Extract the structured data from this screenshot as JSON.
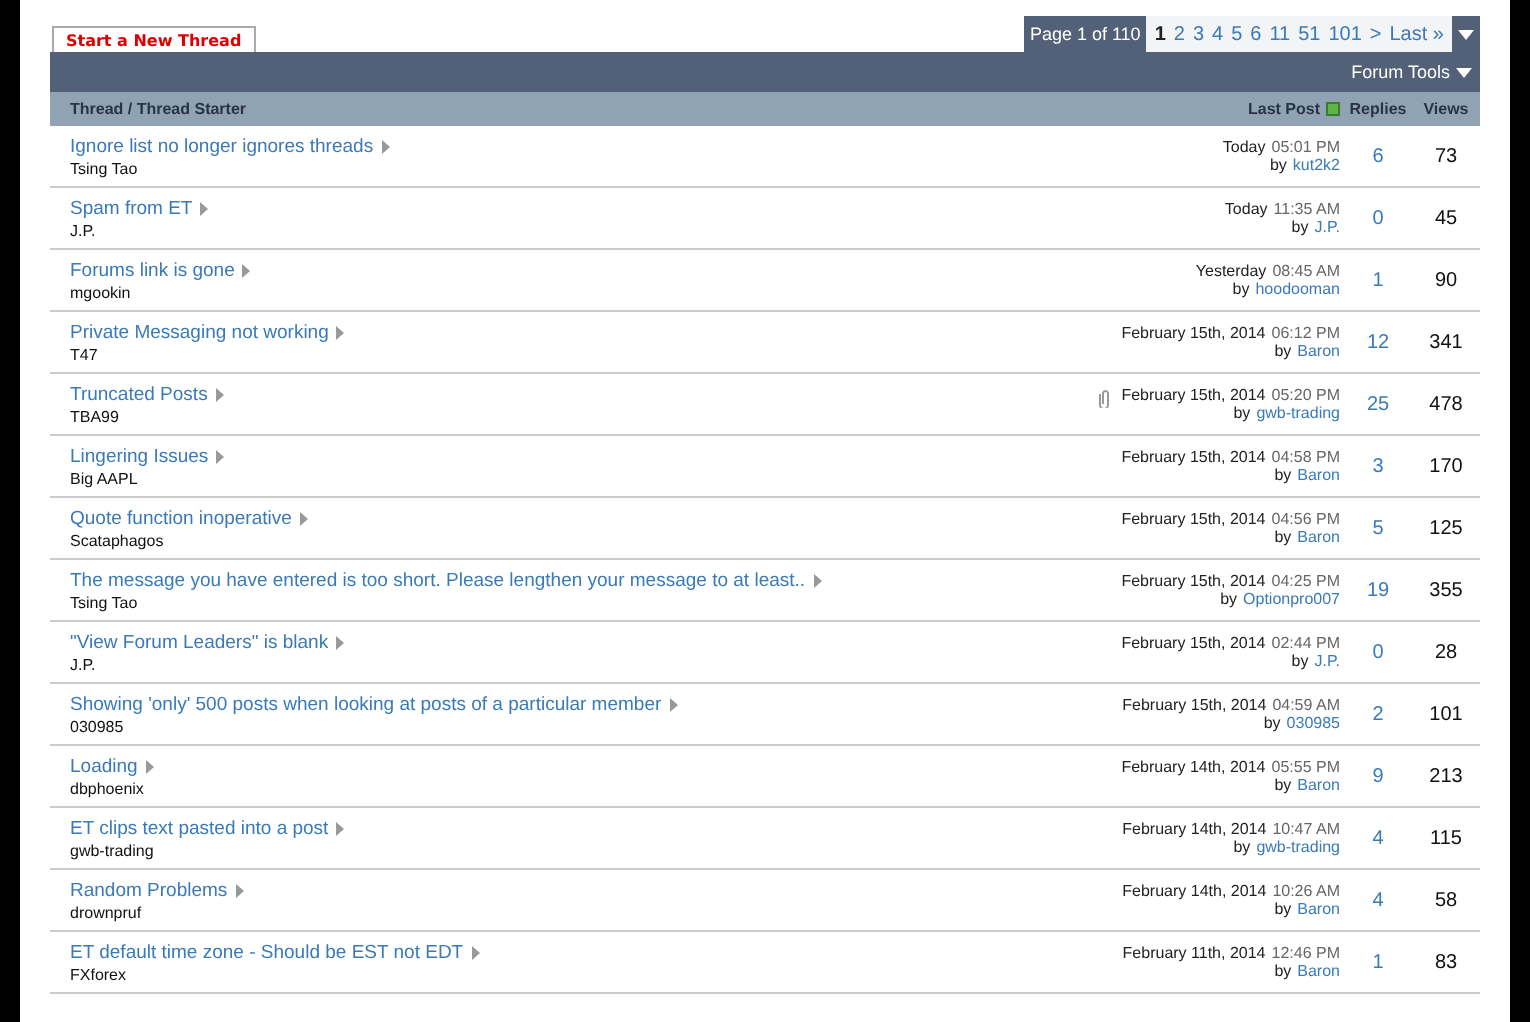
{
  "new_thread_button": "Start a New Thread",
  "pagination": {
    "summary": "Page 1 of 110",
    "pages": [
      {
        "label": "1",
        "selected": true
      },
      {
        "label": "2",
        "selected": false
      },
      {
        "label": "3",
        "selected": false
      },
      {
        "label": "4",
        "selected": false
      },
      {
        "label": "5",
        "selected": false
      },
      {
        "label": "6",
        "selected": false
      },
      {
        "label": "11",
        "selected": false
      },
      {
        "label": "51",
        "selected": false
      },
      {
        "label": "101",
        "selected": false
      }
    ],
    "next": ">",
    "last": "Last »"
  },
  "forum_tools": "Forum Tools",
  "columns": {
    "thread": "Thread / Thread Starter",
    "last_post": "Last Post",
    "replies": "Replies",
    "views": "Views"
  },
  "threads": [
    {
      "title": "Ignore list no longer ignores threads",
      "starter": "Tsing Tao",
      "date": "Today",
      "time": "05:01 PM",
      "by": "by",
      "last_user": "kut2k2",
      "replies": "6",
      "views": "73",
      "attachment": false
    },
    {
      "title": "Spam from ET",
      "starter": "J.P.",
      "date": "Today",
      "time": "11:35 AM",
      "by": "by",
      "last_user": "J.P.",
      "replies": "0",
      "views": "45",
      "attachment": false
    },
    {
      "title": "Forums link is gone",
      "starter": "mgookin",
      "date": "Yesterday",
      "time": "08:45 AM",
      "by": "by",
      "last_user": "hoodooman",
      "replies": "1",
      "views": "90",
      "attachment": false
    },
    {
      "title": "Private Messaging not working",
      "starter": "T47",
      "date": "February 15th, 2014",
      "time": "06:12 PM",
      "by": "by",
      "last_user": "Baron",
      "replies": "12",
      "views": "341",
      "attachment": false
    },
    {
      "title": "Truncated Posts",
      "starter": "TBA99",
      "date": "February 15th, 2014",
      "time": "05:20 PM",
      "by": "by",
      "last_user": "gwb-trading",
      "replies": "25",
      "views": "478",
      "attachment": true
    },
    {
      "title": "Lingering Issues",
      "starter": "Big AAPL",
      "date": "February 15th, 2014",
      "time": "04:58 PM",
      "by": "by",
      "last_user": "Baron",
      "replies": "3",
      "views": "170",
      "attachment": false
    },
    {
      "title": "Quote function inoperative",
      "starter": "Scataphagos",
      "date": "February 15th, 2014",
      "time": "04:56 PM",
      "by": "by",
      "last_user": "Baron",
      "replies": "5",
      "views": "125",
      "attachment": false
    },
    {
      "title": "The message you have entered is too short. Please lengthen your message to at least..",
      "starter": "Tsing Tao",
      "date": "February 15th, 2014",
      "time": "04:25 PM",
      "by": "by",
      "last_user": "Optionpro007",
      "replies": "19",
      "views": "355",
      "attachment": false
    },
    {
      "title": "\"View Forum Leaders\" is blank",
      "starter": "J.P.",
      "date": "February 15th, 2014",
      "time": "02:44 PM",
      "by": "by",
      "last_user": "J.P.",
      "replies": "0",
      "views": "28",
      "attachment": false
    },
    {
      "title": "Showing 'only' 500 posts when looking at posts of a particular member",
      "starter": "030985",
      "date": "February 15th, 2014",
      "time": "04:59 AM",
      "by": "by",
      "last_user": "030985",
      "replies": "2",
      "views": "101",
      "attachment": false
    },
    {
      "title": "Loading",
      "starter": "dbphoenix",
      "date": "February 14th, 2014",
      "time": "05:55 PM",
      "by": "by",
      "last_user": "Baron",
      "replies": "9",
      "views": "213",
      "attachment": false
    },
    {
      "title": "ET clips text pasted into a post",
      "starter": "gwb-trading",
      "date": "February 14th, 2014",
      "time": "10:47 AM",
      "by": "by",
      "last_user": "gwb-trading",
      "replies": "4",
      "views": "115",
      "attachment": false
    },
    {
      "title": "Random Problems",
      "starter": "drownpruf",
      "date": "February 14th, 2014",
      "time": "10:26 AM",
      "by": "by",
      "last_user": "Baron",
      "replies": "4",
      "views": "58",
      "attachment": false
    },
    {
      "title": "ET default time zone - Should be EST not EDT",
      "starter": "FXforex",
      "date": "February 11th, 2014",
      "time": "12:46 PM",
      "by": "by",
      "last_user": "Baron",
      "replies": "1",
      "views": "83",
      "attachment": false
    }
  ]
}
